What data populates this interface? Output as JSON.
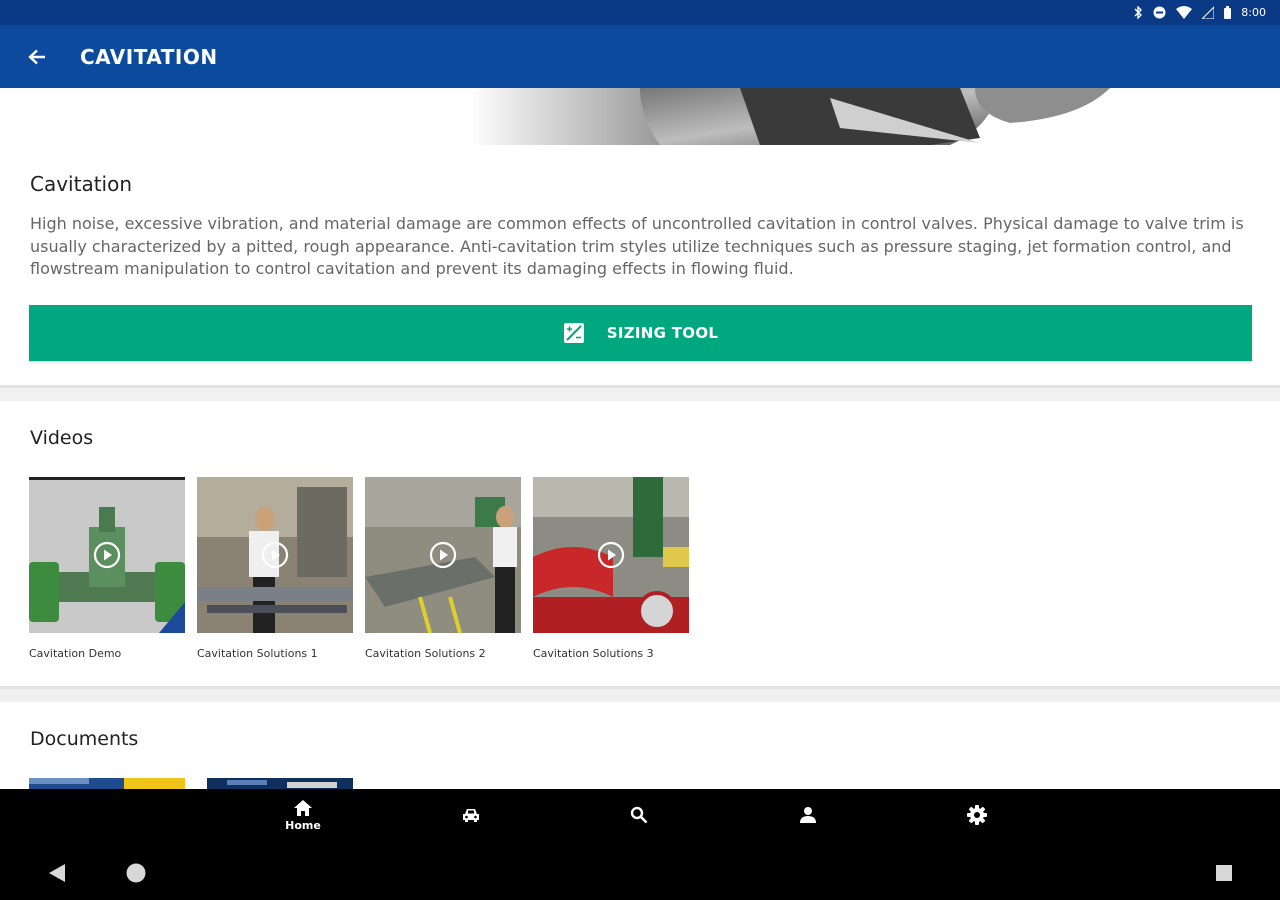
{
  "status_bar": {
    "time": "8:00"
  },
  "app_bar": {
    "title": "CAVITATION"
  },
  "intro": {
    "title": "Cavitation",
    "text": "High noise, excessive vibration, and material damage are common effects of uncontrolled cavitation in control valves. Physical damage to valve trim is usually characterized by a pitted, rough appearance. Anti-cavitation trim styles utilize techniques such as pressure staging, jet formation control, and flowstream manipulation to control cavitation and prevent its damaging effects in flowing fluid.",
    "sizing_button_label": "SIZING TOOL"
  },
  "videos": {
    "title": "Videos",
    "items": [
      {
        "caption": "Cavitation Demo"
      },
      {
        "caption": "Cavitation Solutions 1"
      },
      {
        "caption": "Cavitation Solutions 2"
      },
      {
        "caption": "Cavitation Solutions 3"
      }
    ]
  },
  "documents": {
    "title": "Documents"
  },
  "bottom_nav": {
    "items": [
      {
        "label": "Home",
        "icon": "home-icon",
        "active": true
      },
      {
        "label": "",
        "icon": "car-icon"
      },
      {
        "label": "",
        "icon": "search-icon"
      },
      {
        "label": "",
        "icon": "person-icon"
      },
      {
        "label": "",
        "icon": "gear-icon"
      }
    ]
  },
  "colors": {
    "status_bar": "#0a3a85",
    "app_bar": "#0b4a9d",
    "accent_green": "#00a77f"
  }
}
